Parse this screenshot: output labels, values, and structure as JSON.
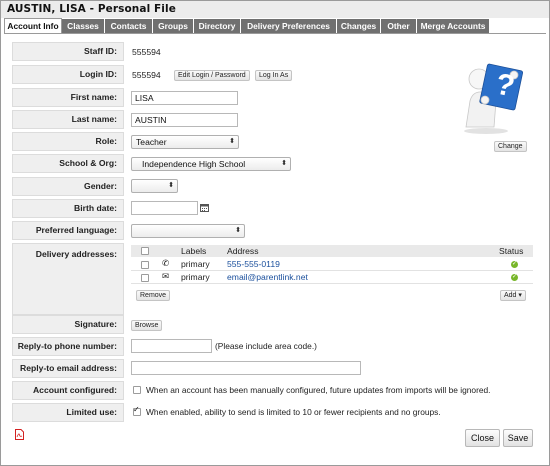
{
  "window": {
    "title": "AUSTIN, LISA - Personal File"
  },
  "tabs": [
    {
      "label": "Account Info",
      "active": true
    },
    {
      "label": "Classes"
    },
    {
      "label": "Contacts"
    },
    {
      "label": "Groups"
    },
    {
      "label": "Directory"
    },
    {
      "label": "Delivery Preferences"
    },
    {
      "label": "Changes"
    },
    {
      "label": "Other"
    },
    {
      "label": "Merge Accounts"
    }
  ],
  "form": {
    "staff_id": {
      "label": "Staff ID:",
      "value": "555594"
    },
    "login_id": {
      "label": "Login ID:",
      "value": "555594",
      "edit_button": "Edit Login / Password",
      "login_as_button": "Log In As"
    },
    "first_name": {
      "label": "First name:",
      "value": "LISA"
    },
    "last_name": {
      "label": "Last name:",
      "value": "AUSTIN"
    },
    "role": {
      "label": "Role:",
      "value": "Teacher"
    },
    "school": {
      "label": "School & Org:",
      "value": "Independence High School"
    },
    "gender": {
      "label": "Gender:",
      "value": ""
    },
    "birth_date": {
      "label": "Birth date:",
      "value": ""
    },
    "preferred_language": {
      "label": "Preferred language:",
      "value": ""
    },
    "delivery": {
      "label": "Delivery addresses:",
      "headers": {
        "labels": "Labels",
        "address": "Address",
        "status": "Status"
      },
      "rows": [
        {
          "type_icon": "phone-icon",
          "icon_glyph": "✆",
          "label": "primary",
          "address": "555-555-0119",
          "status": "ok"
        },
        {
          "type_icon": "envelope-icon",
          "icon_glyph": "✉",
          "label": "primary",
          "address": "email@parentlink.net",
          "status": "ok"
        }
      ],
      "remove_button": "Remove",
      "add_button": "Add ▾"
    },
    "signature": {
      "label": "Signature:",
      "browse_button": "Browse"
    },
    "reply_phone": {
      "label": "Reply-to phone number:",
      "value": "",
      "hint": "(Please include area code.)"
    },
    "reply_email": {
      "label": "Reply-to email address:",
      "value": ""
    },
    "account_configured": {
      "label": "Account configured:",
      "checked": false,
      "text": "When an account has been manually configured, future updates from imports will be ignored."
    },
    "limited_use": {
      "label": "Limited use:",
      "checked": true,
      "text": "When enabled, ability to send is limited to 10 or fewer recipients and no groups."
    }
  },
  "avatar": {
    "change_button": "Change",
    "glyph": "?"
  },
  "footer": {
    "close_button": "Close",
    "save_button": "Save",
    "pdf_icon": "pdf-icon"
  },
  "colors": {
    "tab_bg": "#707070",
    "link": "#1a4f9c",
    "status_ok": "#78b72a",
    "avatar_card": "#2a6fc9"
  }
}
